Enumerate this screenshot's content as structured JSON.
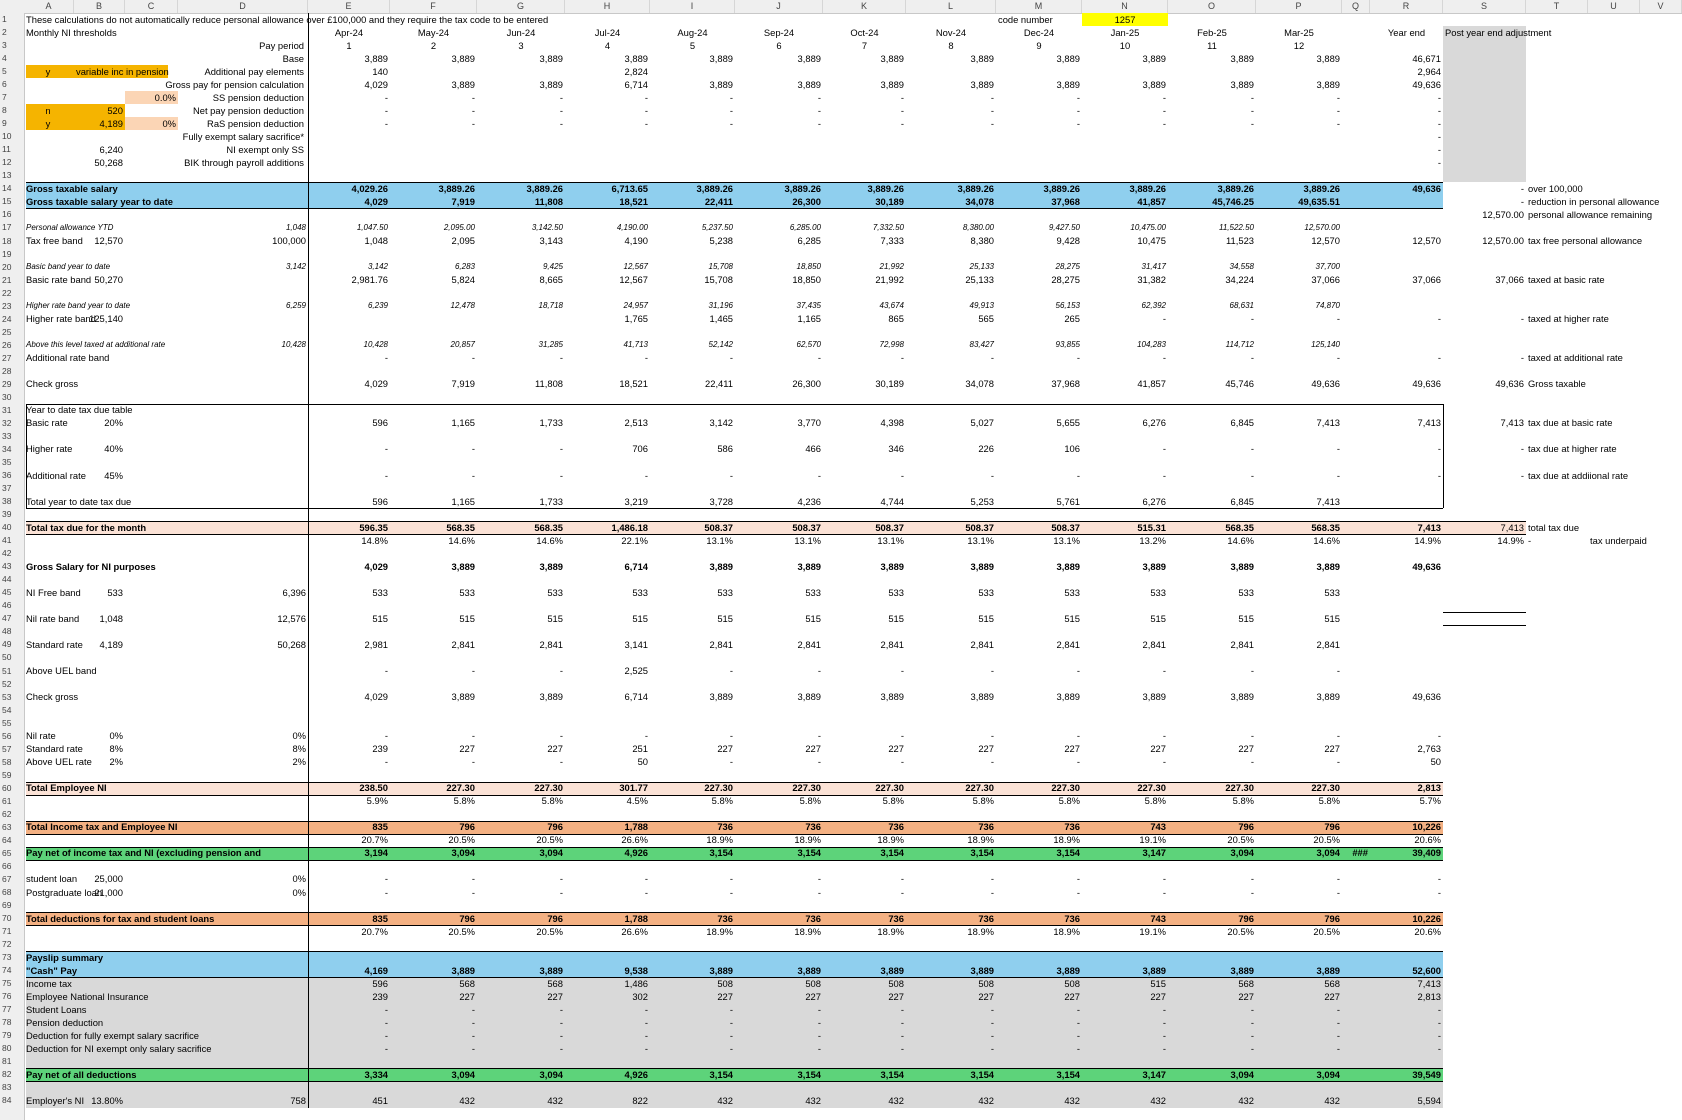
{
  "columns": [
    "A",
    "B",
    "C",
    "D",
    "E",
    "F",
    "G",
    "H",
    "I",
    "J",
    "K",
    "L",
    "M",
    "N",
    "O",
    "P",
    "Q",
    "R",
    "S",
    "T",
    "U",
    "V"
  ],
  "row_numbers": [
    "1",
    "2",
    "3",
    "4",
    "5",
    "6",
    "7",
    "8",
    "9",
    "10",
    "11",
    "12",
    "13",
    "14",
    "15",
    "16",
    "17",
    "18",
    "19",
    "20",
    "21",
    "22",
    "23",
    "24",
    "25",
    "26",
    "27",
    "28",
    "29",
    "30",
    "31",
    "32",
    "33",
    "34",
    "35",
    "36",
    "37",
    "38",
    "39",
    "40",
    "41",
    "42",
    "43",
    "44",
    "45",
    "46",
    "47",
    "48",
    "49",
    "50",
    "51",
    "52",
    "53",
    "54",
    "55",
    "56",
    "57",
    "58",
    "59",
    "60",
    "61",
    "62",
    "63",
    "64",
    "65",
    "66",
    "67",
    "68",
    "69",
    "70",
    "71",
    "72",
    "73",
    "74",
    "75",
    "76",
    "77",
    "78",
    "79",
    "80",
    "81",
    "82",
    "83",
    "84"
  ],
  "colors": {
    "blue_band": "#8fcfee",
    "peach_band": "#fbe2d6",
    "salmon_band": "#f4b183",
    "green_band": "#5dd37a",
    "yellow": "#ffff00",
    "orange": "#f5b400",
    "light_orange": "#fbd5b5",
    "gray": "#d9d9d9"
  },
  "rows": {
    "r1": {
      "A": "These calculations do not automatically reduce personal allowance over £100,000 and they require the tax code to be entered",
      "M": "code number",
      "N": "1257"
    },
    "r2": {
      "A": "Monthly NI thresholds",
      "E": "Apr-24",
      "F": "May-24",
      "G": "Jun-24",
      "H": "Jul-24",
      "I": "Aug-24",
      "J": "Sep-24",
      "K": "Oct-24",
      "L": "Nov-24",
      "M": "Dec-24",
      "N": "Jan-25",
      "O": "Feb-25",
      "P": "Mar-25",
      "R": "Year end",
      "S": "Post year end adjustment"
    },
    "r3": {
      "D": "Pay period",
      "E": "1",
      "F": "2",
      "G": "3",
      "H": "4",
      "I": "5",
      "J": "6",
      "K": "7",
      "L": "8",
      "M": "9",
      "N": "10",
      "O": "11",
      "P": "12"
    },
    "r4": {
      "D": "Base",
      "E": "3,889",
      "F": "3,889",
      "G": "3,889",
      "H": "3,889",
      "I": "3,889",
      "J": "3,889",
      "K": "3,889",
      "L": "3,889",
      "M": "3,889",
      "N": "3,889",
      "O": "3,889",
      "P": "3,889",
      "R": "46,671"
    },
    "r5": {
      "A": "y",
      "B": "variable inc in pension",
      "D": "Additional pay elements",
      "E": "140",
      "H": "2,824",
      "R": "2,964"
    },
    "r6": {
      "D": "Gross pay for pension calculation",
      "E": "4,029",
      "F": "3,889",
      "G": "3,889",
      "H": "6,714",
      "I": "3,889",
      "J": "3,889",
      "K": "3,889",
      "L": "3,889",
      "M": "3,889",
      "N": "3,889",
      "O": "3,889",
      "P": "3,889",
      "R": "49,636"
    },
    "r7": {
      "C": "0.0%",
      "D": "SS pension deduction",
      "E": "-",
      "F": "-",
      "G": "-",
      "H": "-",
      "I": "-",
      "J": "-",
      "K": "-",
      "L": "-",
      "M": "-",
      "N": "-",
      "O": "-",
      "P": "-",
      "R": "-"
    },
    "r8": {
      "A": "n",
      "B": "520",
      "D": "Net pay pension deduction",
      "E": "-",
      "F": "-",
      "G": "-",
      "H": "-",
      "I": "-",
      "J": "-",
      "K": "-",
      "L": "-",
      "M": "-",
      "N": "-",
      "O": "-",
      "P": "-",
      "R": "-"
    },
    "r9": {
      "A": "y",
      "B": "4,189",
      "C": "0%",
      "D": "RaS pension deduction",
      "E": "-",
      "F": "-",
      "G": "-",
      "H": "-",
      "I": "-",
      "J": "-",
      "K": "-",
      "L": "-",
      "M": "-",
      "N": "-",
      "O": "-",
      "P": "-",
      "R": "-"
    },
    "r10": {
      "D": "Fully exempt salary sacrifice*",
      "R": "-"
    },
    "r11": {
      "B": "6,240",
      "D": "NI exempt only SS",
      "R": "-"
    },
    "r12": {
      "B": "50,268",
      "D": "BIK through payroll additions",
      "R": "-"
    },
    "r14": {
      "A": "Gross taxable salary",
      "E": "4,029.26",
      "F": "3,889.26",
      "G": "3,889.26",
      "H": "6,713.65",
      "I": "3,889.26",
      "J": "3,889.26",
      "K": "3,889.26",
      "L": "3,889.26",
      "M": "3,889.26",
      "N": "3,889.26",
      "O": "3,889.26",
      "P": "3,889.26",
      "R": "49,636",
      "S": "-",
      "T": "over 100,000"
    },
    "r15": {
      "A": "Gross taxable salary year to date",
      "E": "4,029",
      "F": "7,919",
      "G": "11,808",
      "H": "18,521",
      "I": "22,411",
      "J": "26,300",
      "K": "30,189",
      "L": "34,078",
      "M": "37,968",
      "N": "41,857",
      "O": "45,746.25",
      "P": "49,635.51",
      "S": "-",
      "T": "reduction in personal allowance"
    },
    "r16": {
      "S": "12,570.00",
      "T": "personal allowance remaining"
    },
    "r17": {
      "A": "Personal allowance YTD",
      "D": "1,048",
      "E": "1,047.50",
      "F": "2,095.00",
      "G": "3,142.50",
      "H": "4,190.00",
      "I": "5,237.50",
      "J": "6,285.00",
      "K": "7,332.50",
      "L": "8,380.00",
      "M": "9,427.50",
      "N": "10,475.00",
      "O": "11,522.50",
      "P": "12,570.00"
    },
    "r18": {
      "A": "Tax free band",
      "B": "12,570",
      "D": "100,000",
      "E": "1,048",
      "F": "2,095",
      "G": "3,143",
      "H": "4,190",
      "I": "5,238",
      "J": "6,285",
      "K": "7,333",
      "L": "8,380",
      "M": "9,428",
      "N": "10,475",
      "O": "11,523",
      "P": "12,570",
      "R": "12,570",
      "S": "12,570.00",
      "T": "tax free personal allowance"
    },
    "r20": {
      "A": "Basic band year to date",
      "D": "3,142",
      "E": "3,142",
      "F": "6,283",
      "G": "9,425",
      "H": "12,567",
      "I": "15,708",
      "J": "18,850",
      "K": "21,992",
      "L": "25,133",
      "M": "28,275",
      "N": "31,417",
      "O": "34,558",
      "P": "37,700"
    },
    "r21": {
      "A": "Basic rate band",
      "B": "50,270",
      "E": "2,981.76",
      "F": "5,824",
      "G": "8,665",
      "H": "12,567",
      "I": "15,708",
      "J": "18,850",
      "K": "21,992",
      "L": "25,133",
      "M": "28,275",
      "N": "31,382",
      "O": "34,224",
      "P": "37,066",
      "R": "37,066",
      "S": "37,066",
      "T": "taxed at basic rate"
    },
    "r23": {
      "A": "Higher rate band year to date",
      "D": "6,259",
      "E": "6,239",
      "F": "12,478",
      "G": "18,718",
      "H": "24,957",
      "I": "31,196",
      "J": "37,435",
      "K": "43,674",
      "L": "49,913",
      "M": "56,153",
      "N": "62,392",
      "O": "68,631",
      "P": "74,870"
    },
    "r24": {
      "A": "Higher rate band",
      "B": "125,140",
      "H": "1,765",
      "I": "1,465",
      "J": "1,165",
      "K": "865",
      "L": "565",
      "M": "265",
      "N": "-",
      "O": "-",
      "P": "-",
      "R": "-",
      "S": "-",
      "T": "taxed at higher rate"
    },
    "r26": {
      "A": "Above this level taxed at additional rate",
      "D": "10,428",
      "E": "10,428",
      "F": "20,857",
      "G": "31,285",
      "H": "41,713",
      "I": "52,142",
      "J": "62,570",
      "K": "72,998",
      "L": "83,427",
      "M": "93,855",
      "N": "104,283",
      "O": "114,712",
      "P": "125,140"
    },
    "r27": {
      "A": "Additional rate band",
      "E": "-",
      "F": "-",
      "G": "-",
      "H": "-",
      "I": "-",
      "J": "-",
      "K": "-",
      "L": "-",
      "M": "-",
      "N": "-",
      "O": "-",
      "P": "-",
      "R": "-",
      "S": "-",
      "T": "taxed at additional rate"
    },
    "r29": {
      "A": "Check gross",
      "E": "4,029",
      "F": "7,919",
      "G": "11,808",
      "H": "18,521",
      "I": "22,411",
      "J": "26,300",
      "K": "30,189",
      "L": "34,078",
      "M": "37,968",
      "N": "41,857",
      "O": "45,746",
      "P": "49,636",
      "R": "49,636",
      "S": "49,636",
      "T": "Gross taxable"
    },
    "r31": {
      "A": "Year to date tax due table"
    },
    "r32": {
      "A": "Basic rate",
      "B": "20%",
      "E": "596",
      "F": "1,165",
      "G": "1,733",
      "H": "2,513",
      "I": "3,142",
      "J": "3,770",
      "K": "4,398",
      "L": "5,027",
      "M": "5,655",
      "N": "6,276",
      "O": "6,845",
      "P": "7,413",
      "R": "7,413",
      "S": "7,413",
      "T": "tax due at basic rate"
    },
    "r34": {
      "A": "Higher rate",
      "B": "40%",
      "E": "-",
      "F": "-",
      "G": "-",
      "H": "706",
      "I": "586",
      "J": "466",
      "K": "346",
      "L": "226",
      "M": "106",
      "N": "-",
      "O": "-",
      "P": "-",
      "R": "-",
      "S": "-",
      "T": "tax due at higher rate"
    },
    "r36": {
      "A": "Additional rate",
      "B": "45%",
      "E": "-",
      "F": "-",
      "G": "-",
      "H": "-",
      "I": "-",
      "J": "-",
      "K": "-",
      "L": "-",
      "M": "-",
      "N": "-",
      "O": "-",
      "P": "-",
      "R": "-",
      "S": "-",
      "T": "tax due at addiional rate"
    },
    "r38": {
      "A": "Total year to date tax due",
      "E": "596",
      "F": "1,165",
      "G": "1,733",
      "H": "3,219",
      "I": "3,728",
      "J": "4,236",
      "K": "4,744",
      "L": "5,253",
      "M": "5,761",
      "N": "6,276",
      "O": "6,845",
      "P": "7,413"
    },
    "r40": {
      "A": "Total tax due for the month",
      "E": "596.35",
      "F": "568.35",
      "G": "568.35",
      "H": "1,486.18",
      "I": "508.37",
      "J": "508.37",
      "K": "508.37",
      "L": "508.37",
      "M": "508.37",
      "N": "515.31",
      "O": "568.35",
      "P": "568.35",
      "R": "7,413",
      "S": "7,413",
      "T": "total tax due"
    },
    "r41": {
      "E": "14.8%",
      "F": "14.6%",
      "G": "14.6%",
      "H": "22.1%",
      "I": "13.1%",
      "J": "13.1%",
      "K": "13.1%",
      "L": "13.1%",
      "M": "13.1%",
      "N": "13.2%",
      "O": "14.6%",
      "P": "14.6%",
      "R": "14.9%",
      "S": "14.9%",
      "T": "-",
      "U": "tax underpaid"
    },
    "r43": {
      "A": "Gross Salary for NI purposes",
      "E": "4,029",
      "F": "3,889",
      "G": "3,889",
      "H": "6,714",
      "I": "3,889",
      "J": "3,889",
      "K": "3,889",
      "L": "3,889",
      "M": "3,889",
      "N": "3,889",
      "O": "3,889",
      "P": "3,889",
      "R": "49,636"
    },
    "r45": {
      "A": "NI Free band",
      "B": "533",
      "D": "6,396",
      "E": "533",
      "F": "533",
      "G": "533",
      "H": "533",
      "I": "533",
      "J": "533",
      "K": "533",
      "L": "533",
      "M": "533",
      "N": "533",
      "O": "533",
      "P": "533"
    },
    "r47": {
      "A": "Nil rate band",
      "B": "1,048",
      "D": "12,576",
      "E": "515",
      "F": "515",
      "G": "515",
      "H": "515",
      "I": "515",
      "J": "515",
      "K": "515",
      "L": "515",
      "M": "515",
      "N": "515",
      "O": "515",
      "P": "515"
    },
    "r49": {
      "A": "Standard rate",
      "B": "4,189",
      "D": "50,268",
      "E": "2,981",
      "F": "2,841",
      "G": "2,841",
      "H": "3,141",
      "I": "2,841",
      "J": "2,841",
      "K": "2,841",
      "L": "2,841",
      "M": "2,841",
      "N": "2,841",
      "O": "2,841",
      "P": "2,841"
    },
    "r51": {
      "A": "Above UEL band",
      "E": "-",
      "F": "-",
      "G": "-",
      "H": "2,525",
      "I": "-",
      "J": "-",
      "K": "-",
      "L": "-",
      "M": "-",
      "N": "-",
      "O": "-",
      "P": "-"
    },
    "r53": {
      "A": "Check gross",
      "E": "4,029",
      "F": "3,889",
      "G": "3,889",
      "H": "6,714",
      "I": "3,889",
      "J": "3,889",
      "K": "3,889",
      "L": "3,889",
      "M": "3,889",
      "N": "3,889",
      "O": "3,889",
      "P": "3,889",
      "R": "49,636"
    },
    "r56": {
      "A": "Nil rate",
      "B": "0%",
      "D": "0%",
      "E": "-",
      "F": "-",
      "G": "-",
      "H": "-",
      "I": "-",
      "J": "-",
      "K": "-",
      "L": "-",
      "M": "-",
      "N": "-",
      "O": "-",
      "P": "-",
      "R": "-"
    },
    "r57": {
      "A": "Standard rate",
      "B": "8%",
      "D": "8%",
      "E": "239",
      "F": "227",
      "G": "227",
      "H": "251",
      "I": "227",
      "J": "227",
      "K": "227",
      "L": "227",
      "M": "227",
      "N": "227",
      "O": "227",
      "P": "227",
      "R": "2,763"
    },
    "r58": {
      "A": "Above UEL rate",
      "B": "2%",
      "D": "2%",
      "E": "-",
      "F": "-",
      "G": "-",
      "H": "50",
      "I": "-",
      "J": "-",
      "K": "-",
      "L": "-",
      "M": "-",
      "N": "-",
      "O": "-",
      "P": "-",
      "R": "50"
    },
    "r60": {
      "A": "Total Employee NI",
      "E": "238.50",
      "F": "227.30",
      "G": "227.30",
      "H": "301.77",
      "I": "227.30",
      "J": "227.30",
      "K": "227.30",
      "L": "227.30",
      "M": "227.30",
      "N": "227.30",
      "O": "227.30",
      "P": "227.30",
      "R": "2,813"
    },
    "r61": {
      "E": "5.9%",
      "F": "5.8%",
      "G": "5.8%",
      "H": "4.5%",
      "I": "5.8%",
      "J": "5.8%",
      "K": "5.8%",
      "L": "5.8%",
      "M": "5.8%",
      "N": "5.8%",
      "O": "5.8%",
      "P": "5.8%",
      "R": "5.7%"
    },
    "r63": {
      "A": "Total Income tax and Employee NI",
      "E": "835",
      "F": "796",
      "G": "796",
      "H": "1,788",
      "I": "736",
      "J": "736",
      "K": "736",
      "L": "736",
      "M": "736",
      "N": "743",
      "O": "796",
      "P": "796",
      "R": "10,226"
    },
    "r64": {
      "E": "20.7%",
      "F": "20.5%",
      "G": "20.5%",
      "H": "26.6%",
      "I": "18.9%",
      "J": "18.9%",
      "K": "18.9%",
      "L": "18.9%",
      "M": "18.9%",
      "N": "19.1%",
      "O": "20.5%",
      "P": "20.5%",
      "R": "20.6%"
    },
    "r65": {
      "A": "Pay net of income tax and NI (excluding pension and",
      "E": "3,194",
      "F": "3,094",
      "G": "3,094",
      "H": "4,926",
      "I": "3,154",
      "J": "3,154",
      "K": "3,154",
      "L": "3,154",
      "M": "3,154",
      "N": "3,147",
      "O": "3,094",
      "P": "3,094",
      "Q": "###",
      "R": "39,409"
    },
    "r67": {
      "A": "student loan",
      "B": "25,000",
      "D": "0%",
      "E": "-",
      "F": "-",
      "G": "-",
      "H": "-",
      "I": "-",
      "J": "-",
      "K": "-",
      "L": "-",
      "M": "-",
      "N": "-",
      "O": "-",
      "P": "-",
      "R": "-"
    },
    "r68": {
      "A": "Postgraduate loan",
      "B": "21,000",
      "D": "0%",
      "E": "-",
      "F": "-",
      "G": "-",
      "H": "-",
      "I": "-",
      "J": "-",
      "K": "-",
      "L": "-",
      "M": "-",
      "N": "-",
      "O": "-",
      "P": "-",
      "R": "-"
    },
    "r70": {
      "A": "Total deductions for tax and student loans",
      "E": "835",
      "F": "796",
      "G": "796",
      "H": "1,788",
      "I": "736",
      "J": "736",
      "K": "736",
      "L": "736",
      "M": "736",
      "N": "743",
      "O": "796",
      "P": "796",
      "R": "10,226"
    },
    "r71": {
      "E": "20.7%",
      "F": "20.5%",
      "G": "20.5%",
      "H": "26.6%",
      "I": "18.9%",
      "J": "18.9%",
      "K": "18.9%",
      "L": "18.9%",
      "M": "18.9%",
      "N": "19.1%",
      "O": "20.5%",
      "P": "20.5%",
      "R": "20.6%"
    },
    "r73": {
      "A": "Payslip summary"
    },
    "r74": {
      "A": "\"Cash\" Pay",
      "E": "4,169",
      "F": "3,889",
      "G": "3,889",
      "H": "9,538",
      "I": "3,889",
      "J": "3,889",
      "K": "3,889",
      "L": "3,889",
      "M": "3,889",
      "N": "3,889",
      "O": "3,889",
      "P": "3,889",
      "R": "52,600"
    },
    "r75": {
      "A": "Income tax",
      "E": "596",
      "F": "568",
      "G": "568",
      "H": "1,486",
      "I": "508",
      "J": "508",
      "K": "508",
      "L": "508",
      "M": "508",
      "N": "515",
      "O": "568",
      "P": "568",
      "R": "7,413"
    },
    "r76": {
      "A": "Employee National Insurance",
      "E": "239",
      "F": "227",
      "G": "227",
      "H": "302",
      "I": "227",
      "J": "227",
      "K": "227",
      "L": "227",
      "M": "227",
      "N": "227",
      "O": "227",
      "P": "227",
      "R": "2,813"
    },
    "r77": {
      "A": "Student Loans",
      "E": "-",
      "F": "-",
      "G": "-",
      "H": "-",
      "I": "-",
      "J": "-",
      "K": "-",
      "L": "-",
      "M": "-",
      "N": "-",
      "O": "-",
      "P": "-",
      "R": "-"
    },
    "r78": {
      "A": "Pension deduction",
      "E": "-",
      "F": "-",
      "G": "-",
      "H": "-",
      "I": "-",
      "J": "-",
      "K": "-",
      "L": "-",
      "M": "-",
      "N": "-",
      "O": "-",
      "P": "-",
      "R": "-"
    },
    "r79": {
      "A": "Deduction for fully exempt salary sacrifice",
      "E": "-",
      "F": "-",
      "G": "-",
      "H": "-",
      "I": "-",
      "J": "-",
      "K": "-",
      "L": "-",
      "M": "-",
      "N": "-",
      "O": "-",
      "P": "-",
      "R": "-"
    },
    "r80": {
      "A": "Deduction for NI exempt only salary sacrifice",
      "E": "-",
      "F": "-",
      "G": "-",
      "H": "-",
      "I": "-",
      "J": "-",
      "K": "-",
      "L": "-",
      "M": "-",
      "N": "-",
      "O": "-",
      "P": "-",
      "R": "-"
    },
    "r82": {
      "A": "Pay net of all deductions",
      "E": "3,334",
      "F": "3,094",
      "G": "3,094",
      "H": "4,926",
      "I": "3,154",
      "J": "3,154",
      "K": "3,154",
      "L": "3,154",
      "M": "3,154",
      "N": "3,147",
      "O": "3,094",
      "P": "3,094",
      "R": "39,549"
    },
    "r84": {
      "A": "Employer's NI",
      "B": "13.80%",
      "D": "758",
      "E": "451",
      "F": "432",
      "G": "432",
      "H": "822",
      "I": "432",
      "J": "432",
      "K": "432",
      "L": "432",
      "M": "432",
      "N": "432",
      "O": "432",
      "P": "432",
      "R": "5,594"
    }
  }
}
